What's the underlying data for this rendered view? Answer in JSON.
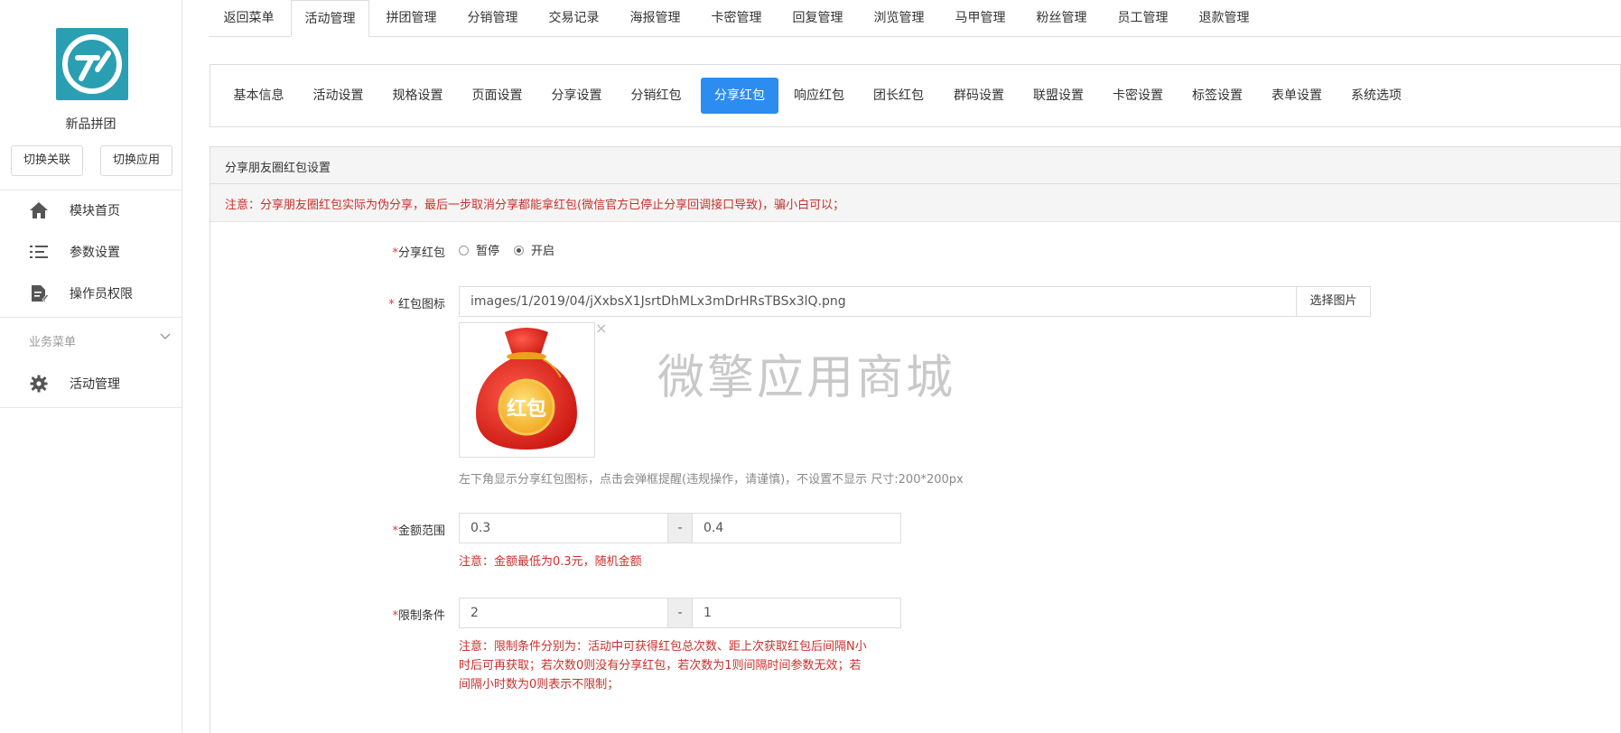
{
  "sidebar": {
    "app_name": "新品拼团",
    "switch_link_label": "切换关联",
    "switch_app_label": "切换应用",
    "items": [
      {
        "label": "模块首页",
        "icon": "home-icon"
      },
      {
        "label": "参数设置",
        "icon": "list-settings-icon"
      },
      {
        "label": "操作员权限",
        "icon": "document-edit-icon"
      }
    ],
    "section_title": "业务菜单",
    "section_items": [
      {
        "label": "活动管理",
        "icon": "gear-icon"
      }
    ]
  },
  "top_tabs": [
    {
      "label": "返回菜单"
    },
    {
      "label": "活动管理",
      "active": true
    },
    {
      "label": "拼团管理"
    },
    {
      "label": "分销管理"
    },
    {
      "label": "交易记录"
    },
    {
      "label": "海报管理"
    },
    {
      "label": "卡密管理"
    },
    {
      "label": "回复管理"
    },
    {
      "label": "浏览管理"
    },
    {
      "label": "马甲管理"
    },
    {
      "label": "粉丝管理"
    },
    {
      "label": "员工管理"
    },
    {
      "label": "退款管理"
    }
  ],
  "sub_tabs": [
    {
      "label": "基本信息"
    },
    {
      "label": "活动设置"
    },
    {
      "label": "规格设置"
    },
    {
      "label": "页面设置"
    },
    {
      "label": "分享设置"
    },
    {
      "label": "分销红包"
    },
    {
      "label": "分享红包",
      "active": true
    },
    {
      "label": "响应红包"
    },
    {
      "label": "团长红包"
    },
    {
      "label": "群码设置"
    },
    {
      "label": "联盟设置"
    },
    {
      "label": "卡密设置"
    },
    {
      "label": "标签设置"
    },
    {
      "label": "表单设置"
    },
    {
      "label": "系统选项"
    }
  ],
  "panel": {
    "title": "分享朋友圈红包设置",
    "notice": "注意：分享朋友圈红包实际为伪分享，最后一步取消分享都能拿红包(微信官方已停止分享回调接口导致)，骗小白可以；"
  },
  "form": {
    "share_redpack": {
      "label": "分享红包",
      "options": [
        "暂停",
        "开启"
      ],
      "selected": "开启"
    },
    "redpack_icon": {
      "label": "红包图标",
      "value": "images/1/2019/04/jXxbsX1JsrtDhMLx3mDrHRsTBSx3lQ.png",
      "button_label": "选择图片",
      "close_symbol": "×",
      "image_text": "红包",
      "help": "左下角显示分享红包图标，点击会弹框提醒(违规操作，请谨慎)，不设置不显示 尺寸:200*200px"
    },
    "watermark": "微擎应用商城",
    "amount_range": {
      "label": "金额范围",
      "min": "0.3",
      "max": "0.4",
      "separator": "-",
      "help": "注意：金额最低为0.3元，随机金额"
    },
    "limit": {
      "label": "限制条件",
      "count": "2",
      "hours": "1",
      "separator": "-",
      "help_lines": [
        "注意：限制条件分别为：活动中可获得红包总次数、距上次获取红包后间隔N小",
        "时后可再获取；若次数0则没有分享红包，若次数为1则间隔时间参数无效；若",
        "间隔小时数为0则表示不限制；"
      ]
    }
  },
  "colors": {
    "primary": "#2d8cf0",
    "danger": "#c9302c",
    "logo": "#2a9fb2"
  }
}
